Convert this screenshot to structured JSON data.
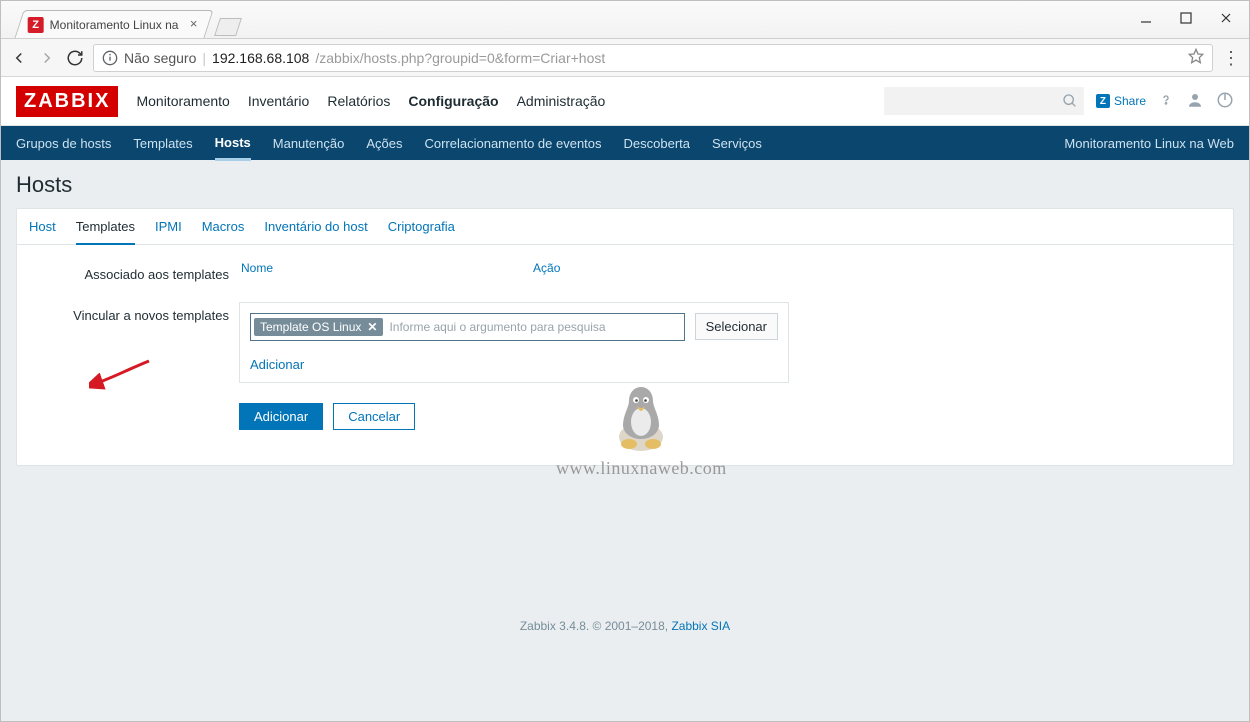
{
  "browser": {
    "tab_title": "Monitoramento Linux na",
    "url_insecure": "Não seguro",
    "url_host": "192.168.68.108",
    "url_path": "/zabbix/hosts.php?groupid=0&form=Criar+host"
  },
  "header": {
    "logo": "ZABBIX",
    "menu": [
      "Monitoramento",
      "Inventário",
      "Relatórios",
      "Configuração",
      "Administração"
    ],
    "active_menu_index": 3,
    "share": "Share"
  },
  "subnav": {
    "items": [
      "Grupos de hosts",
      "Templates",
      "Hosts",
      "Manutenção",
      "Ações",
      "Correlacionamento de eventos",
      "Descoberta",
      "Serviços"
    ],
    "active_index": 2,
    "right": "Monitoramento Linux na Web"
  },
  "page": {
    "title": "Hosts",
    "tabs": [
      "Host",
      "Templates",
      "IPMI",
      "Macros",
      "Inventário do host",
      "Criptografia"
    ],
    "active_tab_index": 1
  },
  "form": {
    "linked_label": "Associado aos templates",
    "linked_cols": {
      "name": "Nome",
      "action": "Ação"
    },
    "link_new_label": "Vincular a novos templates",
    "tag": "Template OS Linux",
    "placeholder": "Informe aqui o argumento para pesquisa",
    "select_btn": "Selecionar",
    "add_link": "Adicionar",
    "submit": "Adicionar",
    "cancel": "Cancelar"
  },
  "footer": {
    "text_prefix": "Zabbix 3.4.8. © 2001–2018, ",
    "link": "Zabbix SIA"
  },
  "watermark": {
    "text": "www.linuxnaweb.com"
  }
}
